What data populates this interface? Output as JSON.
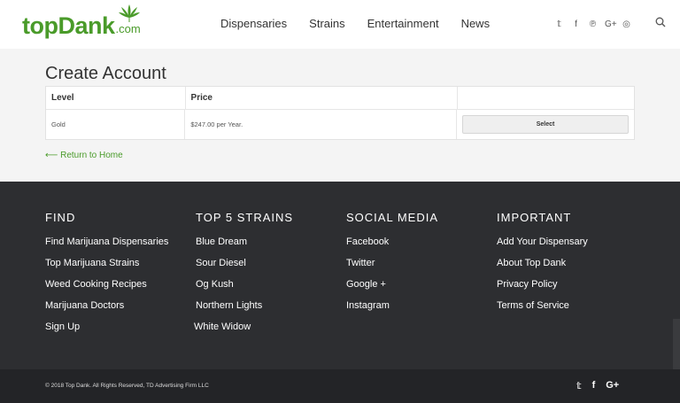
{
  "header": {
    "logo": {
      "top": "top",
      "dank": "Dank",
      "dotcom": ".com"
    },
    "nav": [
      "Dispensaries",
      "Strains",
      "Entertainment",
      "News"
    ],
    "social_icons": [
      "twitter-icon",
      "facebook-icon",
      "pinterest-icon",
      "google-plus-icon",
      "instagram-icon"
    ],
    "social_glyphs": [
      "𝕥",
      "f",
      "℗",
      "G+",
      "◎"
    ]
  },
  "main": {
    "title": "Create Account",
    "table": {
      "headers": [
        "Level",
        "Price",
        ""
      ],
      "rows": [
        {
          "level": "Gold",
          "price": "$247.00 per Year.",
          "action": "Select"
        }
      ]
    },
    "return_link": "⟵ Return to Home"
  },
  "footer": {
    "columns": [
      {
        "heading": "FIND",
        "items": [
          "Find Marijuana Dispensaries",
          "Top Marijuana Strains",
          "Weed Cooking Recipes",
          "Marijuana Doctors",
          "Sign Up"
        ]
      },
      {
        "heading": "TOP 5 STRAINS",
        "items": [
          "Blue Dream",
          "Sour Diesel",
          "Og Kush",
          "Northern Lights",
          "White Widow"
        ]
      },
      {
        "heading": "SOCIAL MEDIA",
        "items": [
          "Facebook",
          "Twitter",
          "Google +",
          "Instagram"
        ]
      },
      {
        "heading": "IMPORTANT",
        "items": [
          "Add Your Dispensary",
          "About Top Dank",
          "Privacy Policy",
          "Terms of Service"
        ]
      }
    ],
    "copyright": "© 2018 Top Dank. All Rights Reserved, TD Advertising Firm LLC",
    "bottom_social": [
      "𝕥",
      "f",
      "G+"
    ]
  },
  "colors": {
    "brand_green": "#4a9b2a",
    "footer_bg": "#2d2e31",
    "bottom_bg": "#232427",
    "content_bg": "#f4f4f4"
  }
}
